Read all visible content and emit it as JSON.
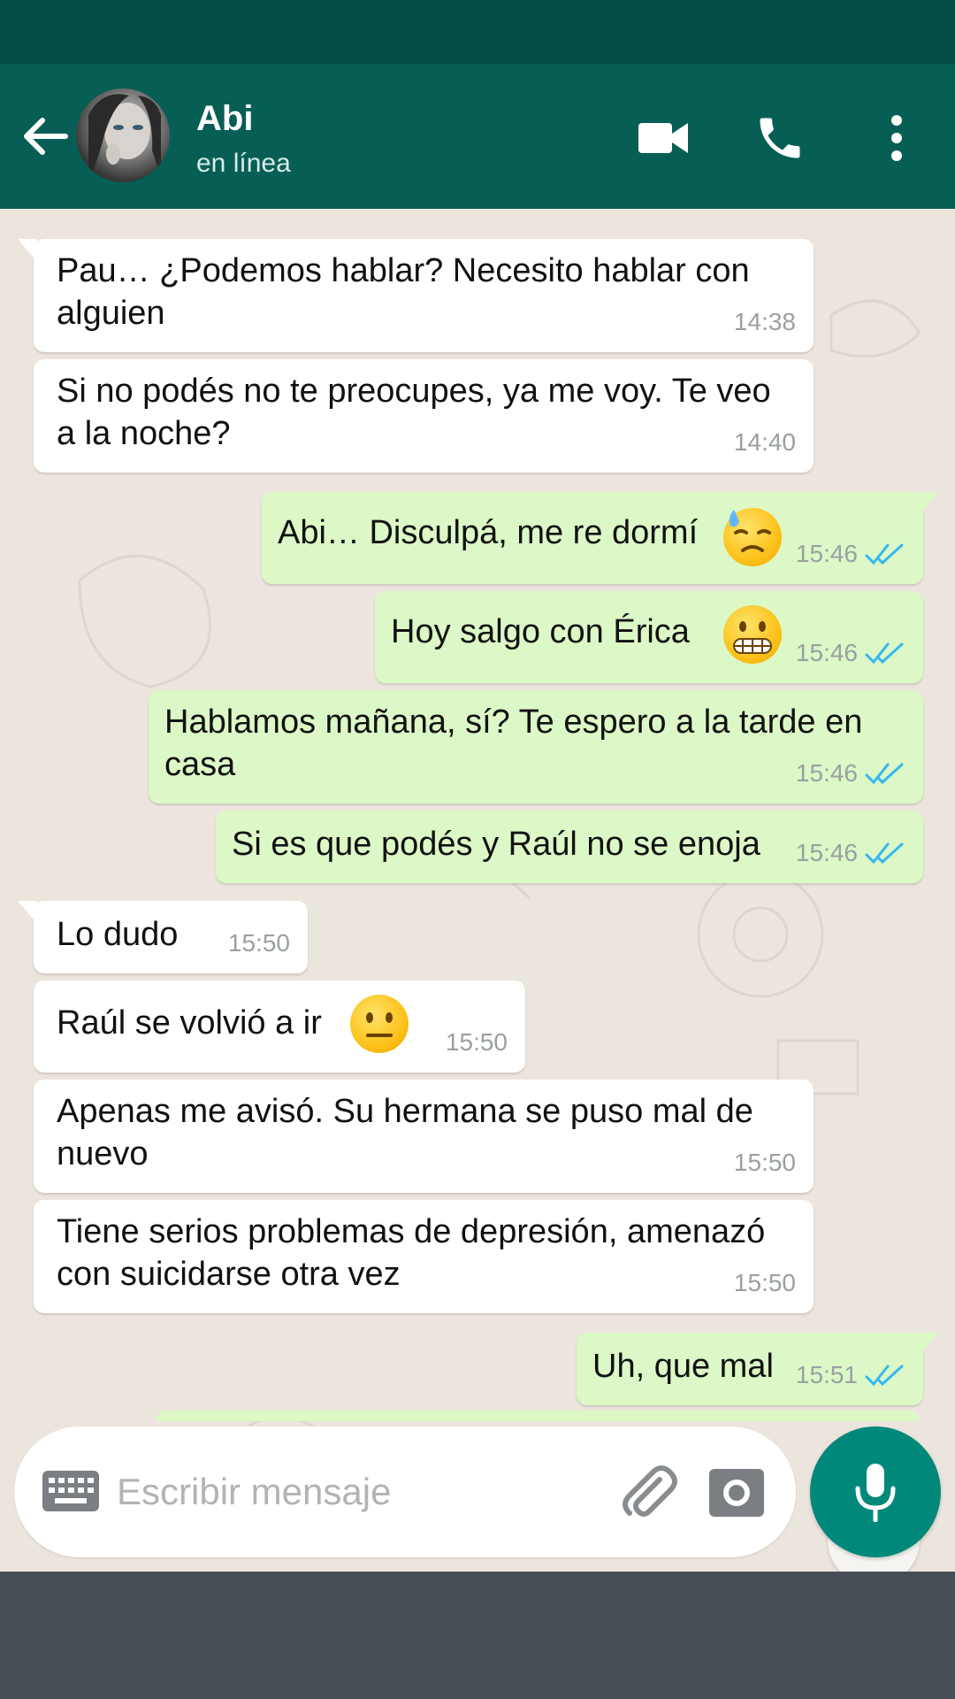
{
  "header": {
    "contact_name": "Abi",
    "contact_status": "en línea"
  },
  "messages": [
    {
      "text": "Pau… ¿Podemos hablar? Necesito hablar con alguien",
      "time": "14:38",
      "direction": "in"
    },
    {
      "text": "Si no podés no te preocupes, ya me voy. Te veo a la noche?",
      "time": "14:40",
      "direction": "in"
    },
    {
      "text": "Abi… Disculpá, me re dormí",
      "emoji": "downcast-face-with-sweat",
      "time": "15:46",
      "direction": "out",
      "status": "read"
    },
    {
      "text": "Hoy salgo con Érica",
      "emoji": "grimacing-face",
      "time": "15:46",
      "direction": "out",
      "status": "read"
    },
    {
      "text": "Hablamos mañana, sí? Te espero a la tarde en casa",
      "time": "15:46",
      "direction": "out",
      "status": "read"
    },
    {
      "text": "Si es que podés y Raúl no se enoja",
      "time": "15:46",
      "direction": "out",
      "status": "read"
    },
    {
      "text": "Lo dudo",
      "time": "15:50",
      "direction": "in"
    },
    {
      "text": "Raúl se volvió a ir",
      "emoji": "neutral-face",
      "time": "15:50",
      "direction": "in"
    },
    {
      "text": "Apenas me avisó. Su hermana se puso mal de nuevo",
      "time": "15:50",
      "direction": "in"
    },
    {
      "text": "Tiene serios problemas de depresión, amenazó con suicidarse otra vez",
      "time": "15:50",
      "direction": "in"
    },
    {
      "text": "Uh, que mal",
      "time": "15:51",
      "direction": "out",
      "status": "read"
    }
  ],
  "composer": {
    "placeholder": "Escribir mensaje"
  },
  "colors": {
    "header": "#075e54",
    "status_bar": "#054d44",
    "chat_bg": "#ece5dd",
    "outgoing": "#dcf8c6",
    "incoming": "#ffffff",
    "accent": "#00897b",
    "read_tick": "#34b7f1"
  },
  "icons": [
    "back-arrow-icon",
    "video-call-icon",
    "phone-icon",
    "more-vert-icon",
    "scroll-down-icon",
    "keyboard-icon",
    "attach-icon",
    "camera-icon",
    "mic-icon"
  ]
}
